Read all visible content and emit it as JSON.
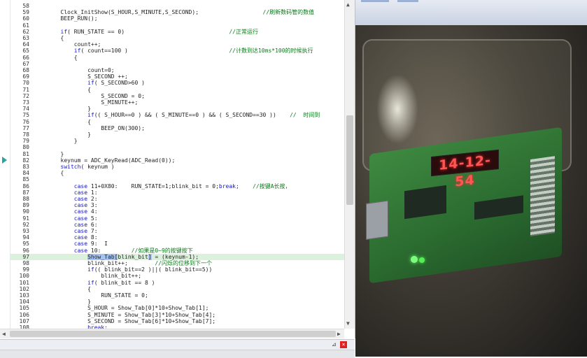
{
  "editor": {
    "lines": [
      {
        "n": "58",
        "code": ""
      },
      {
        "n": "59",
        "code": "        Clock_InitShow(S_HOUR,S_MINUTE,S_SECOND);                   //刷新数码管的数值"
      },
      {
        "n": "60",
        "code": "        BEEP_RUN();"
      },
      {
        "n": "61",
        "code": ""
      },
      {
        "n": "62",
        "code": "        if( RUN_STATE == 0)                               //正常运行"
      },
      {
        "n": "63",
        "code": "        {"
      },
      {
        "n": "64",
        "code": "            count++;"
      },
      {
        "n": "65",
        "code": "            if( count==100 )                              //计数到达10ms*100的时候执行"
      },
      {
        "n": "66",
        "code": "            {"
      },
      {
        "n": "67",
        "code": ""
      },
      {
        "n": "68",
        "code": "                count=0;"
      },
      {
        "n": "69",
        "code": "                S_SECOND ++;"
      },
      {
        "n": "70",
        "code": "                if( S_SECOND>60 )"
      },
      {
        "n": "71",
        "code": "                {"
      },
      {
        "n": "72",
        "code": "                    S_SECOND = 0;"
      },
      {
        "n": "73",
        "code": "                    S_MINUTE++;"
      },
      {
        "n": "74",
        "code": "                }"
      },
      {
        "n": "75",
        "code": "                if(( S_HOUR==0 ) && ( S_MINUTE==0 ) && ( S_SECOND==30 ))    //  时间到"
      },
      {
        "n": "76",
        "code": "                {"
      },
      {
        "n": "77",
        "code": "                    BEEP_ON(300);"
      },
      {
        "n": "78",
        "code": "                }"
      },
      {
        "n": "79",
        "code": "            }"
      },
      {
        "n": "80",
        "code": ""
      },
      {
        "n": "81",
        "code": "        }"
      },
      {
        "n": "82",
        "code": "        keynum = ADC_KeyRead(ADC_Read(0));"
      },
      {
        "n": "83",
        "code": "        switch( keynum )"
      },
      {
        "n": "84",
        "code": "        {"
      },
      {
        "n": "85",
        "code": ""
      },
      {
        "n": "86",
        "code": "            case 11+0X80:    RUN_STATE=1;blink_bit = 0;break;    //按键A长按，"
      },
      {
        "n": "87",
        "code": "            case 1:"
      },
      {
        "n": "88",
        "code": "            case 2:"
      },
      {
        "n": "89",
        "code": "            case 3:"
      },
      {
        "n": "90",
        "code": "            case 4:"
      },
      {
        "n": "91",
        "code": "            case 5:"
      },
      {
        "n": "92",
        "code": "            case 6:"
      },
      {
        "n": "93",
        "code": "            case 7:"
      },
      {
        "n": "94",
        "code": "            case 8:"
      },
      {
        "n": "95",
        "code": "            case 9:  I"
      },
      {
        "n": "96",
        "code": "            case 10:         //如果是0~9的按键按下"
      },
      {
        "n": "97",
        "code": "                Show_Tab[blink_bit] = (keynum-1);"
      },
      {
        "n": "98",
        "code": "                blink_bit++;        //闪烁的位移到下一个"
      },
      {
        "n": "99",
        "code": "                if(( blink_bit==2 )||( blink_bit==5))"
      },
      {
        "n": "100",
        "code": "                    blink_bit++;"
      },
      {
        "n": "101",
        "code": "                if( blink_bit == 8 )"
      },
      {
        "n": "102",
        "code": "                {"
      },
      {
        "n": "103",
        "code": "                    RUN_STATE = 0;"
      },
      {
        "n": "104",
        "code": "                }"
      },
      {
        "n": "105",
        "code": "                S_HOUR = Show_Tab[0]*10+Show_Tab[1];"
      },
      {
        "n": "106",
        "code": "                S_MINUTE = Show_Tab[3]*10+Show_Tab[4];"
      },
      {
        "n": "107",
        "code": "                S_SECOND = Show_Tab[6]*10+Show_Tab[7];"
      },
      {
        "n": "108",
        "code": "                break;"
      }
    ],
    "highlight_line": "97",
    "breakpoint_lines": [
      "82"
    ]
  },
  "panel": {
    "pin_icon": "pin-icon",
    "close_icon": "close-icon",
    "close_glyph": "×",
    "pin_glyph": "⊿"
  },
  "video": {
    "led_display": "14-12-54",
    "led_color": "#ff4444"
  },
  "colors": {
    "keyword": "#1515c7",
    "comment": "#0a7a18",
    "current_line": "#dbf1db"
  }
}
